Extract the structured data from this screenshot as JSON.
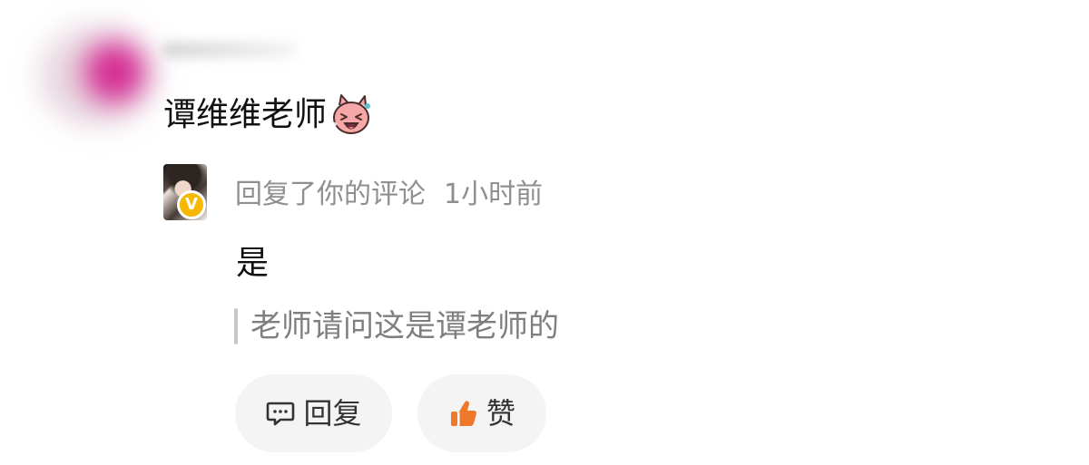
{
  "post": {
    "comment_text": "谭维维老师"
  },
  "reply": {
    "action_text": "回复了你的评论",
    "time": "1小时前",
    "content": "是",
    "quoted_text": "老师请问这是谭老师的"
  },
  "actions": {
    "reply_label": "回复",
    "like_label": "赞"
  },
  "colors": {
    "verified_badge": "#f6b800",
    "meta_text": "#8f8f8f",
    "quote_bar": "#c8c8c8",
    "button_bg": "#f4f4f4",
    "like_icon": "#f0782a"
  },
  "icons": {
    "emoji": "laughing-cat-emoji",
    "reply": "comment-bubble-icon",
    "like": "thumbs-up-icon"
  }
}
